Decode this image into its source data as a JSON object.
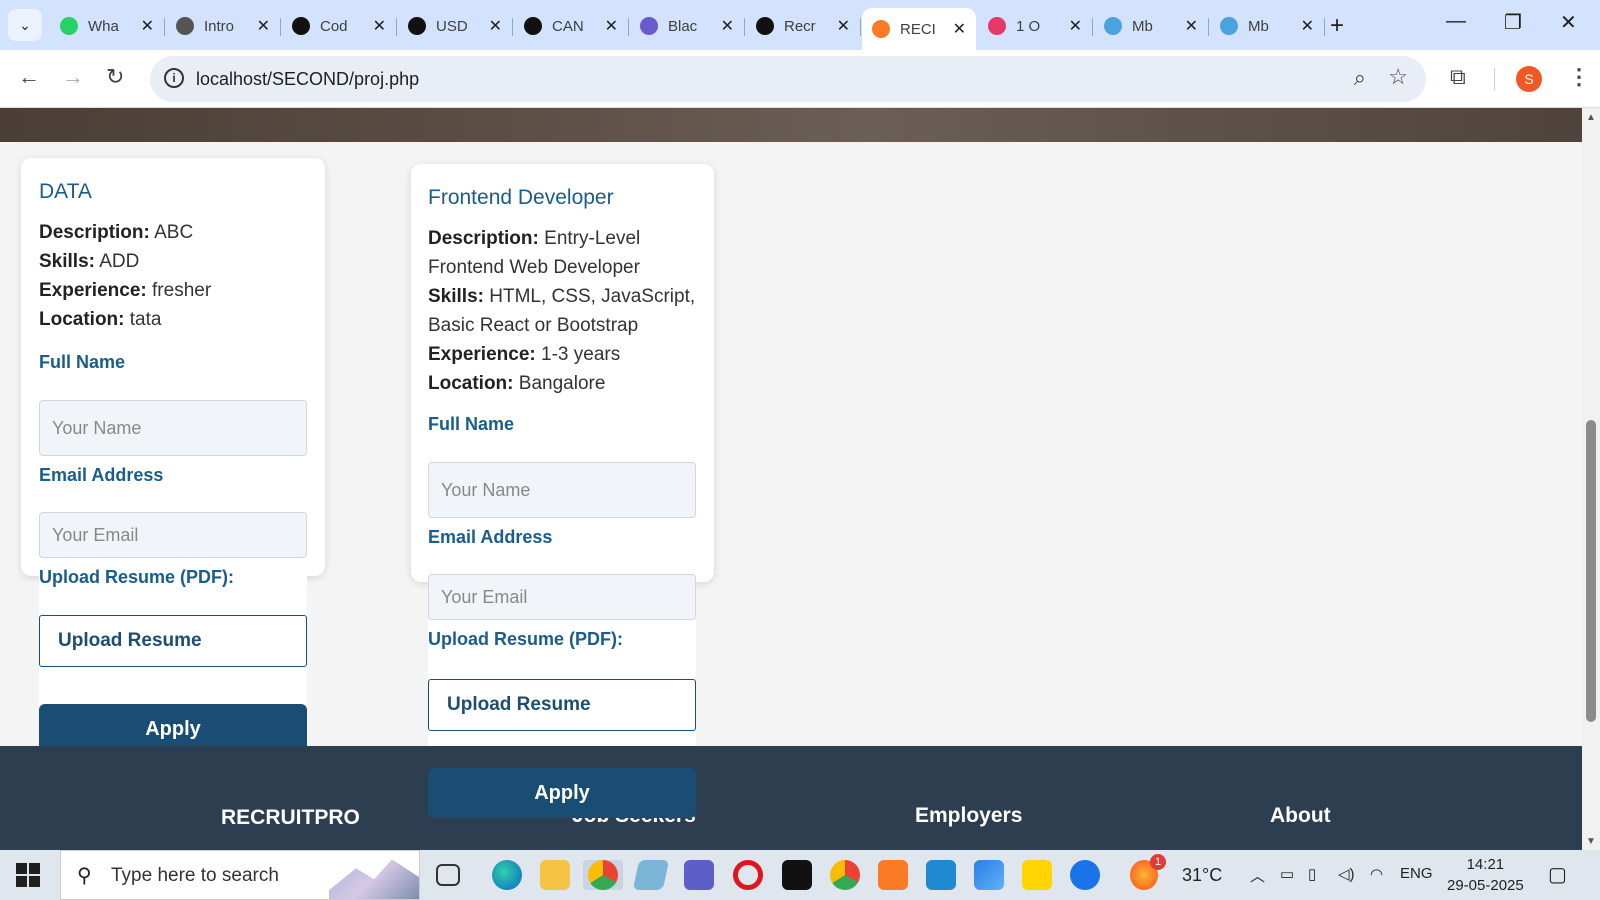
{
  "browser": {
    "tabs": [
      {
        "title": "Wha",
        "color": "#25d366"
      },
      {
        "title": "Intro",
        "color": "#555555"
      },
      {
        "title": "Cod",
        "color": "#111111"
      },
      {
        "title": "USD",
        "color": "#111111"
      },
      {
        "title": "CAN",
        "color": "#111111"
      },
      {
        "title": "Blac",
        "color": "#6a5acd"
      },
      {
        "title": "Recr",
        "color": "#111111"
      },
      {
        "title": "RECI",
        "color": "#fb7a24"
      },
      {
        "title": "1 O",
        "color": "#e8386a"
      },
      {
        "title": "Mb",
        "color": "#4aa3df"
      },
      {
        "title": "Mb",
        "color": "#4aa3df"
      }
    ],
    "active_tab_index": 7,
    "url": "localhost/SECOND/proj.php",
    "avatar_letter": "S"
  },
  "jobs": [
    {
      "title": "DATA",
      "description_label": "Description:",
      "description": "ABC",
      "skills_label": "Skills:",
      "skills": "ADD",
      "experience_label": "Experience:",
      "experience": "fresher",
      "location_label": "Location:",
      "location": "tata",
      "name_label": "Full Name",
      "name_placeholder": "Your Name",
      "email_label": "Email Address",
      "email_placeholder": "Your Email",
      "resume_label": "Upload Resume (PDF):",
      "upload_label": "Upload Resume",
      "apply_label": "Apply"
    },
    {
      "title": "Frontend Developer",
      "description_label": "Description:",
      "description": "Entry-Level Frontend Web Developer",
      "skills_label": "Skills:",
      "skills": "HTML, CSS, JavaScript, Basic React or Bootstrap",
      "experience_label": "Experience:",
      "experience": "1-3 years",
      "location_label": "Location:",
      "location": "Bangalore",
      "name_label": "Full Name",
      "name_placeholder": "Your Name",
      "email_label": "Email Address",
      "email_placeholder": "Your Email",
      "resume_label": "Upload Resume (PDF):",
      "upload_label": "Upload Resume",
      "apply_label": "Apply"
    }
  ],
  "footer": {
    "brand": "RECRUITPRO",
    "columns": [
      "Job Seekers",
      "Employers",
      "About"
    ]
  },
  "taskbar": {
    "search_placeholder": "Type here to search",
    "weather": "31°C",
    "weather_badge": "1",
    "language": "ENG",
    "time": "14:21",
    "date": "29-05-2025"
  }
}
